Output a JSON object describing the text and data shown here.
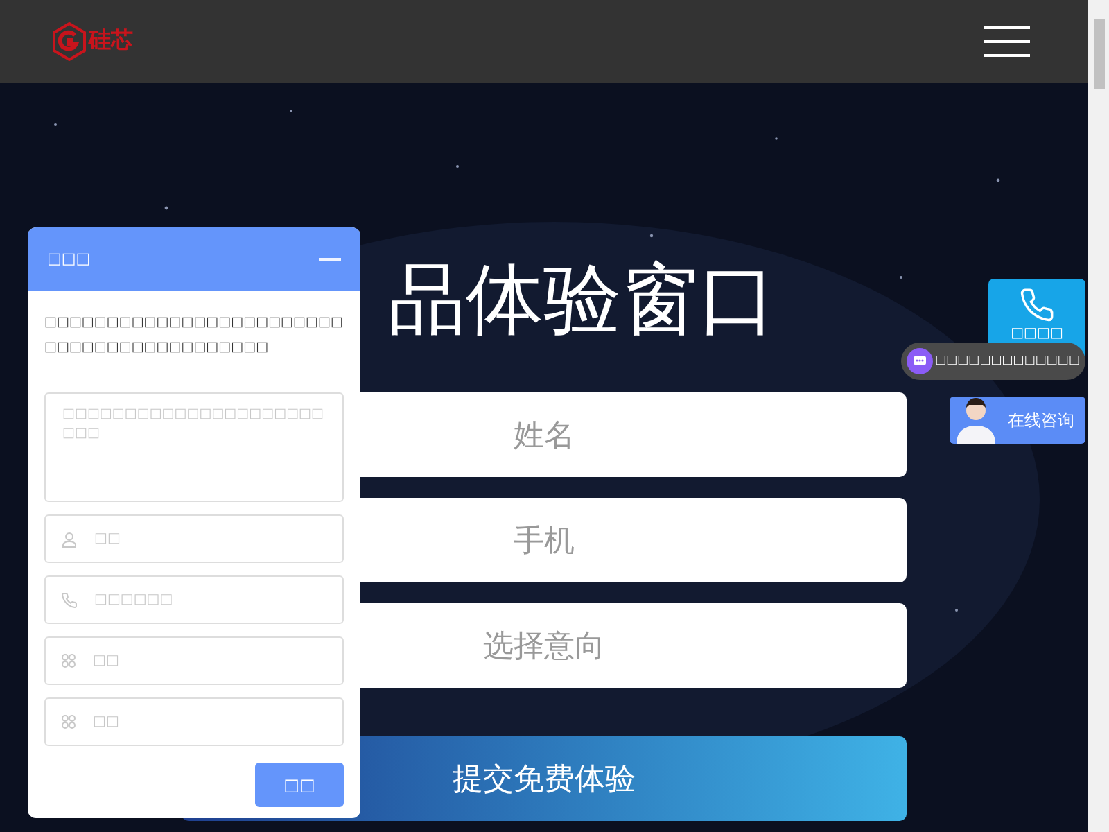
{
  "header": {
    "logo_text": "硅芯"
  },
  "hero": {
    "title": "品体验窗口",
    "fields": [
      {
        "placeholder": "姓名"
      },
      {
        "placeholder": "手机"
      },
      {
        "placeholder": "选择意向"
      }
    ],
    "submit": "提交免费体验"
  },
  "chat_panel": {
    "title": "□□□",
    "message": "□□□□□□□□□□□□□□□□□□□□□□□□□□□□□□□□□□□□□□□□□□",
    "textarea_placeholder": "□□□□□□□□□□□□□□□□□□□□□□□□",
    "fields": [
      {
        "kind": "person",
        "placeholder": "□□"
      },
      {
        "kind": "phone",
        "placeholder": "□□□□□□"
      },
      {
        "kind": "grid",
        "placeholder": "□□"
      },
      {
        "kind": "grid",
        "placeholder": "□□"
      }
    ],
    "submit": "□□"
  },
  "side_widgets": {
    "phone_label": "□□□□",
    "chat_pill": "□□□□□□□□□□□□□",
    "consult": "在线咨询"
  }
}
